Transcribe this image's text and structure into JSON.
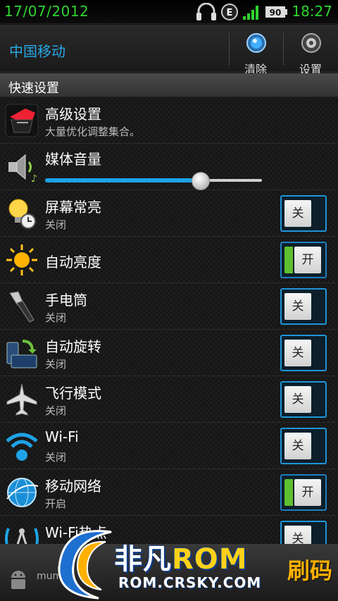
{
  "status_bar": {
    "date": "17/07/2012",
    "time": "18:27",
    "battery_level": "90",
    "network_type": "E",
    "icons": [
      "headset-icon",
      "edge-network-icon",
      "signal-icon",
      "battery-icon"
    ],
    "accent_color": "#2fd52f"
  },
  "header": {
    "carrier": "中国移动",
    "clear_label": "清除",
    "settings_label": "设置",
    "accent_color": "#29a8e6"
  },
  "section_title": "快速设置",
  "items": [
    {
      "title": "高级设置",
      "subtitle": "大量优化调整集合。",
      "icon": "advanced-settings-icon"
    },
    {
      "title": "媒体音量",
      "icon": "speaker-icon",
      "volume_fraction": 0.716
    },
    {
      "title": "屏幕常亮",
      "subtitle": "关闭",
      "icon": "bulb-timer-icon",
      "toggle": "关",
      "on": false
    },
    {
      "title": "自动亮度",
      "icon": "sun-icon",
      "toggle": "开",
      "on": true
    },
    {
      "title": "手电筒",
      "subtitle": "关闭",
      "icon": "flashlight-icon",
      "toggle": "关",
      "on": false
    },
    {
      "title": "自动旋转",
      "subtitle": "关闭",
      "icon": "rotate-icon",
      "toggle": "关",
      "on": false
    },
    {
      "title": "飞行模式",
      "subtitle": "关闭",
      "icon": "airplane-icon",
      "toggle": "关",
      "on": false
    },
    {
      "title": "Wi-Fi",
      "subtitle": "关闭",
      "icon": "wifi-icon",
      "toggle": "关",
      "on": false
    },
    {
      "title": "移动网络",
      "subtitle": "开启",
      "icon": "globe-icon",
      "toggle": "开",
      "on": true
    },
    {
      "title": "Wi-Fi热点",
      "icon": "hotspot-icon",
      "toggle": "关",
      "on": false
    }
  ],
  "watermark": {
    "brand": "非凡",
    "brand_rom": "ROM",
    "url": "ROM.CRSKY.COM",
    "right_text": "刷码"
  },
  "bottom_bar": {
    "text": "mumay"
  }
}
